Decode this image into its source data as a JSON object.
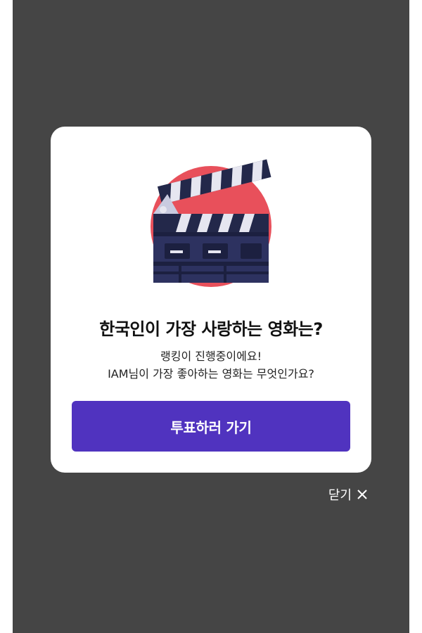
{
  "popup": {
    "title": "한국인이 가장 사랑하는 영화는?",
    "subtitle_line1": "랭킹이 진행중이에요!",
    "subtitle_line2": "IAM님이 가장 좋아하는 영화는 무엇인가요?",
    "cta_label": "투표하러 가기",
    "hero_icon": "movie-clapperboard-icon"
  },
  "close": {
    "label": "닫기",
    "icon": "close-icon"
  },
  "colors": {
    "backdrop": "#454545",
    "accent": "#5033bf",
    "hero_circle": "#e8505b",
    "clapper_dark": "#23284a"
  }
}
